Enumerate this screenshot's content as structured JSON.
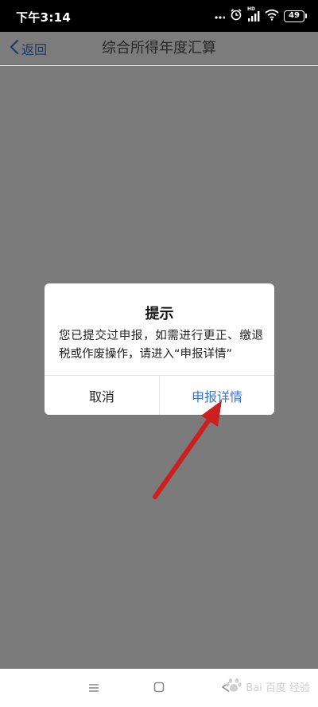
{
  "status_bar": {
    "time": "下午3:14",
    "network_badge": "HD",
    "battery_level": "49"
  },
  "header": {
    "back_label": "返回",
    "title": "综合所得年度汇算"
  },
  "dialog": {
    "title": "提示",
    "message": "您已提交过申报，如需进行更正、缴退税或作废操作，请进入“申报详情”",
    "cancel_label": "取消",
    "confirm_label": "申报详情"
  },
  "annotation": {
    "arrow_color": "#cc1f1f"
  },
  "watermark": {
    "logo": "Bai 百度",
    "suffix": "经验"
  },
  "colors": {
    "accent": "#3b73c7",
    "overlay": "#7b7b7b"
  }
}
